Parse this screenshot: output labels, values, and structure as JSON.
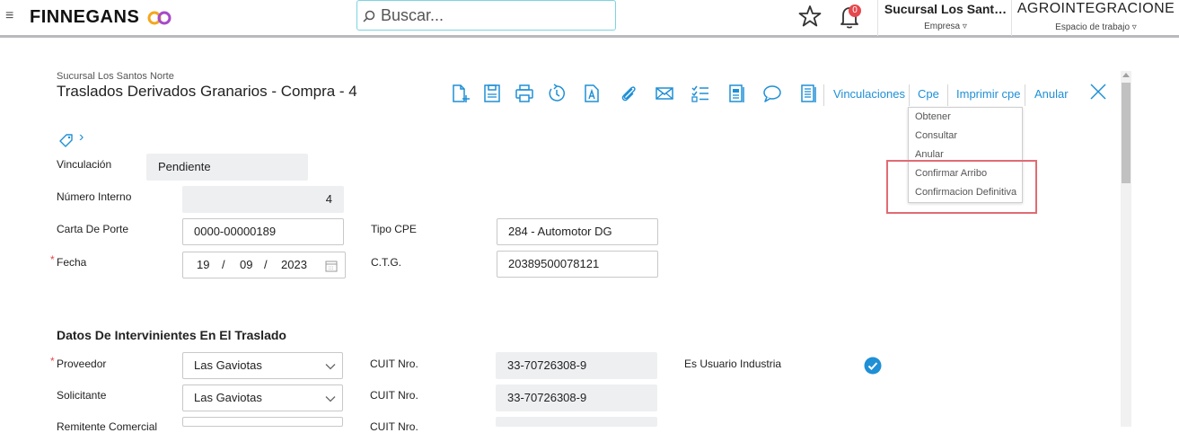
{
  "header": {
    "logo_text": "FINNEGANS",
    "search_placeholder": "Buscar...",
    "notifications_count": "0",
    "branch_name": "Sucursal Los Sant…",
    "branch_label": "Empresa ▿",
    "company_name": "AGROINTEGRACIONE",
    "company_label": "Espacio de trabajo ▿"
  },
  "doc": {
    "subtitle": "Sucursal Los Santos Norte",
    "title": "Traslados Derivados Granarios - Compra - 4",
    "breadcrumb_chevron": "›"
  },
  "toolbar": {
    "icons": [
      "new-document-icon",
      "save-icon",
      "print-icon",
      "history-icon",
      "text-document-icon",
      "attachment-icon",
      "email-icon",
      "checklist-icon",
      "report-icon",
      "comment-icon",
      "list-document-icon"
    ],
    "links": [
      "Vinculaciones",
      "Cpe",
      "Imprimir cpe",
      "Anular"
    ]
  },
  "cpe_menu": {
    "items": [
      "Obtener",
      "Consultar",
      "Anular",
      "Confirmar Arribo",
      "Confirmacion Definitiva"
    ]
  },
  "form": {
    "vinculacion_label": "Vinculación",
    "vinculacion_value": "Pendiente",
    "numero_interno_label": "Número Interno",
    "numero_interno_value": "4",
    "carta_porte_label": "Carta De Porte",
    "carta_porte_value": "0000-00000189",
    "tipo_cpe_label": "Tipo CPE",
    "tipo_cpe_value": "284 - Automotor DG",
    "fecha_label": "Fecha",
    "fecha_day": "19",
    "fecha_month": "09",
    "fecha_year": "2023",
    "date_sep": "/",
    "ctg_label": "C.T.G.",
    "ctg_value": "20389500078121",
    "required_mark": "*"
  },
  "intervinientes": {
    "section_title": "Datos De Intervinientes En El Traslado",
    "proveedor_label": "Proveedor",
    "proveedor_value": "Las Gaviotas",
    "cuit_label": "CUIT Nro.",
    "proveedor_cuit": "33-70726308-9",
    "usuario_industria_label": "Es Usuario Industria",
    "solicitante_label": "Solicitante",
    "solicitante_value": "Las Gaviotas",
    "solicitante_cuit": "33-70726308-9",
    "remitente_label": "Remitente Comercial",
    "remitente_cuit_label": "CUIT Nro."
  },
  "colors": {
    "accent": "#1f8fd6",
    "highlight": "#e06b74",
    "badge": "#e5484d"
  }
}
